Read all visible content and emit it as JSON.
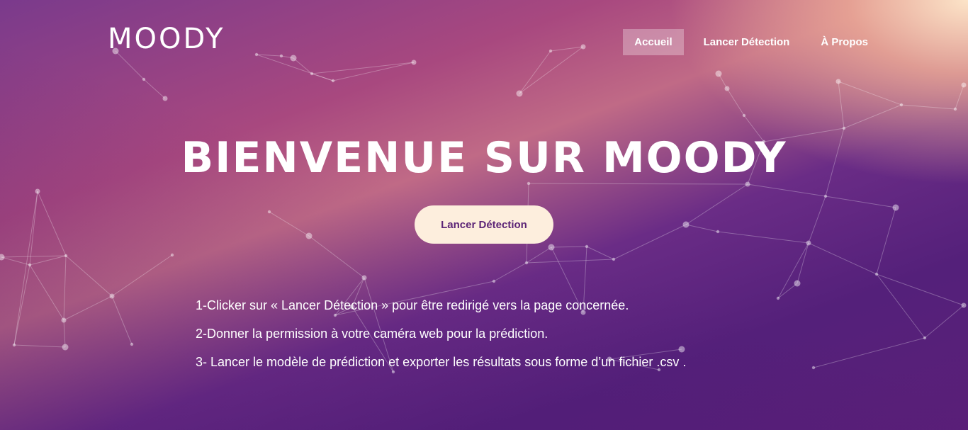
{
  "header": {
    "logo_text": "MOODY",
    "nav": [
      {
        "label": "Accueil",
        "active": true
      },
      {
        "label": "Lancer Détection",
        "active": false
      },
      {
        "label": "À Propos",
        "active": false
      }
    ]
  },
  "hero": {
    "title": "BIENVENUE SUR MOODY",
    "cta_label": "Lancer Détection",
    "steps": [
      "1-Clicker sur « Lancer Détection » pour être redirigé vers la page concernée.",
      "2-Donner la permission à votre caméra web pour la prédiction.",
      "3- Lancer le modèle de prédiction et exporter les résultats sous forme d’un fichier .csv ."
    ]
  },
  "colors": {
    "accent_button_bg": "#fdeedd",
    "accent_button_text": "#5c2476",
    "background_start": "#7a3a8c",
    "background_end": "#5a1f78"
  },
  "icons": [
    "logo-smile-icon",
    "logo-frown-icon"
  ]
}
